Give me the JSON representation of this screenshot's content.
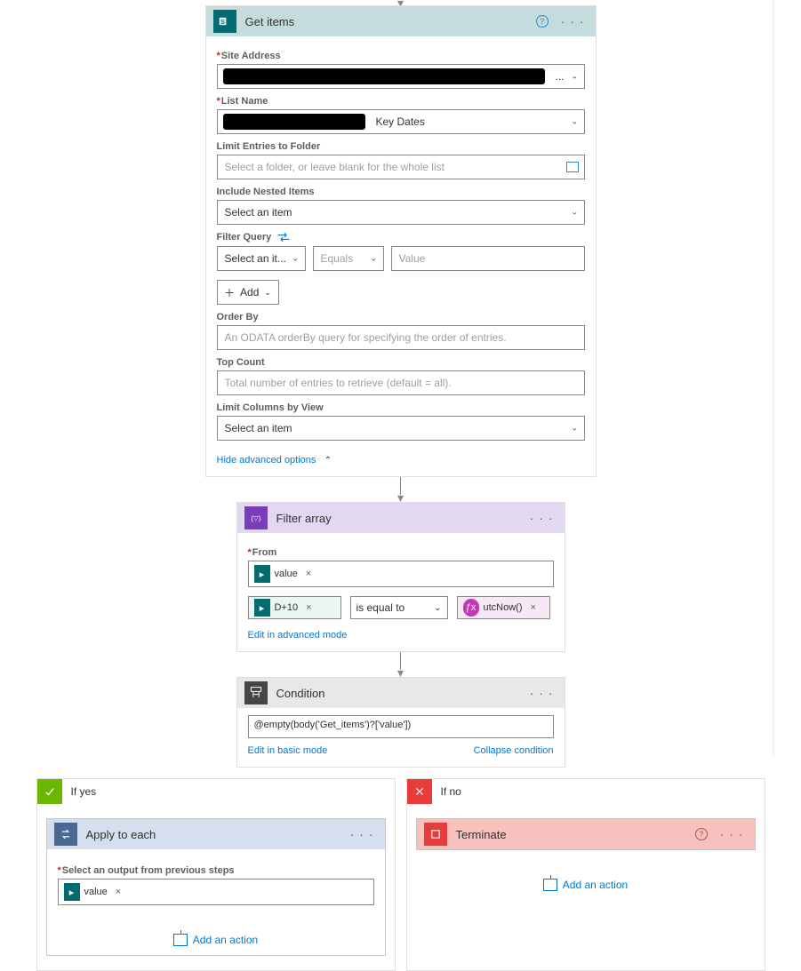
{
  "getItems": {
    "title": "Get items",
    "fields": {
      "siteAddress": {
        "label": "Site Address",
        "valueSuffix": "..."
      },
      "listName": {
        "label": "List Name",
        "visibleText": "Key Dates"
      },
      "limitFolder": {
        "label": "Limit Entries to Folder",
        "placeholder": "Select a folder, or leave blank for the whole list"
      },
      "includeNested": {
        "label": "Include Nested Items",
        "value": "Select an item"
      },
      "filterQuery": {
        "label": "Filter Query",
        "col": "Select an it...",
        "op": "Equals",
        "val": "Value",
        "add": "Add"
      },
      "orderBy": {
        "label": "Order By",
        "placeholder": "An ODATA orderBy query for specifying the order of entries."
      },
      "topCount": {
        "label": "Top Count",
        "placeholder": "Total number of entries to retrieve (default = all)."
      },
      "limitColumns": {
        "label": "Limit Columns by View",
        "value": "Select an item"
      }
    },
    "hideAdvanced": "Hide advanced options"
  },
  "filterArray": {
    "title": "Filter array",
    "fromLabel": "From",
    "fromToken": "value",
    "left": "D+10",
    "op": "is equal to",
    "right": "utcNow()",
    "editAdvanced": "Edit in advanced mode"
  },
  "condition": {
    "title": "Condition",
    "expression": "@empty(body('Get_items')?['value'])",
    "editBasic": "Edit in basic mode",
    "collapse": "Collapse condition"
  },
  "branches": {
    "yes": {
      "title": "If yes",
      "apply": {
        "title": "Apply to each",
        "selectLabel": "Select an output from previous steps",
        "token": "value"
      },
      "addAction": "Add an action"
    },
    "no": {
      "title": "If no",
      "terminate": {
        "title": "Terminate"
      },
      "addAction": "Add an action"
    }
  }
}
